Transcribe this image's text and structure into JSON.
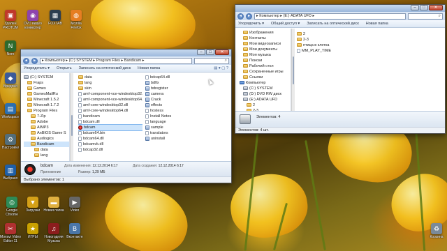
{
  "desktop": {
    "icons": [
      {
        "label": "Удален PROTUM",
        "glyph": "▣",
        "color": "#c0392b"
      },
      {
        "label": "DVD видео конвертер",
        "glyph": "◉",
        "color": "#8e44ad"
      },
      {
        "label": "FOXTAB",
        "glyph": "▦",
        "color": "#2c3e50"
      },
      {
        "label": "Mozilla Firefox",
        "glyph": "◍",
        "color": "#e67e22"
      },
      {
        "label": "Nero",
        "glyph": "N",
        "color": "#2d6a2d"
      },
      {
        "label": "Вредоно",
        "glyph": "◆",
        "color": "#3b5b9a"
      },
      {
        "label": "Workspace",
        "glyph": "▤",
        "color": "#2c6fb0"
      },
      {
        "label": "Настройки",
        "glyph": "⚙",
        "color": "#546e7a"
      },
      {
        "label": "Выбрано",
        "glyph": "▥",
        "color": "#1f5fa8"
      },
      {
        "label": "Google Chrome",
        "glyph": "◎",
        "color": "#2e8b57"
      },
      {
        "label": "Загрузки",
        "glyph": "▼",
        "color": "#d4a017"
      },
      {
        "label": "Новая папка",
        "glyph": "▬",
        "color": "#e0b040"
      },
      {
        "label": "Video",
        "glyph": "▶",
        "color": "#666"
      },
      {
        "label": "Movavi Video Editor 11",
        "glyph": "✂",
        "color": "#b03030"
      },
      {
        "label": "ИГРЫ",
        "glyph": "★",
        "color": "#c9a100"
      },
      {
        "label": "Новогодняя Музыка",
        "glyph": "♫",
        "color": "#8b1d1d"
      },
      {
        "label": "Вконтакте",
        "glyph": "B",
        "color": "#4a76a8"
      },
      {
        "label": "Корзина",
        "glyph": "♻",
        "color": "#7a8a9a"
      }
    ]
  },
  "usb_window": {
    "address": "▸ Компьютер ▸ (E:) ADATA UFD ▸",
    "toolbar": [
      "Упорядочить ▾",
      "Общий доступ ▾",
      "Записать на оптический диск",
      "Новая папка"
    ],
    "tree": [
      {
        "label": "Изображения",
        "kind": "folder",
        "indent": 1
      },
      {
        "label": "Контакты",
        "kind": "folder",
        "indent": 1
      },
      {
        "label": "Мои видеозаписи",
        "kind": "folder",
        "indent": 1
      },
      {
        "label": "Мои документы",
        "kind": "folder",
        "indent": 1
      },
      {
        "label": "Моя музыка",
        "kind": "folder",
        "indent": 1
      },
      {
        "label": "Поиски",
        "kind": "folder",
        "indent": 1
      },
      {
        "label": "Рабочий стол",
        "kind": "folder",
        "indent": 1
      },
      {
        "label": "Сохраненные игры",
        "kind": "folder",
        "indent": 1
      },
      {
        "label": "Ссылки",
        "kind": "folder",
        "indent": 1
      },
      {
        "label": "Компьютер",
        "kind": "sys",
        "indent": 0
      },
      {
        "label": "(C:) SYSTEM",
        "kind": "drive",
        "indent": 1
      },
      {
        "label": "(D:) DVD RW диск",
        "kind": "drive",
        "indent": 1
      },
      {
        "label": "(E:) ADATA UFD",
        "kind": "drive",
        "indent": 1
      },
      {
        "label": "2",
        "kind": "folder",
        "indent": 2
      },
      {
        "label": "2-3",
        "kind": "folder",
        "indent": 2
      },
      {
        "label": "птица в клетка",
        "kind": "folder",
        "indent": 2
      }
    ],
    "files": [
      "2",
      "2-3",
      "птица в клетка",
      "MM_PLAY_TIME"
    ],
    "status_count": "Элементов: 4",
    "status_bar": "Элементов: 4 шт."
  },
  "bandicam_window": {
    "address": "▸ Компьютер ▸ (C:) SYSTEM ▸ Program Files ▸ Bandicam ▸",
    "toolbar": [
      "Упорядочить ▾",
      "Открыть",
      "Записать на оптический диск",
      "Новая папка"
    ],
    "tree": [
      {
        "label": "(C:) SYSTEM",
        "kind": "drive",
        "indent": 0
      },
      {
        "label": "Fraps",
        "kind": "folder",
        "indent": 1
      },
      {
        "label": "Games",
        "kind": "folder",
        "indent": 1
      },
      {
        "label": "GamesMailRu",
        "kind": "folder",
        "indent": 1
      },
      {
        "label": "Minecraft 1.5.2",
        "kind": "folder",
        "indent": 1
      },
      {
        "label": "Minecraft 1.7.2",
        "kind": "folder",
        "indent": 1
      },
      {
        "label": "Program Files",
        "kind": "folder",
        "indent": 1
      },
      {
        "label": "7-Zip",
        "kind": "folder",
        "indent": 2
      },
      {
        "label": "Adobe",
        "kind": "folder",
        "indent": 2
      },
      {
        "label": "AIMP3",
        "kind": "folder",
        "indent": 2
      },
      {
        "label": "AnBIOS Game S",
        "kind": "folder",
        "indent": 2
      },
      {
        "label": "Audiogics",
        "kind": "folder",
        "indent": 2
      },
      {
        "label": "Bandicam",
        "kind": "folder",
        "indent": 2,
        "selected": true
      },
      {
        "label": "data",
        "kind": "folder",
        "indent": 3
      },
      {
        "label": "lang",
        "kind": "folder",
        "indent": 3
      }
    ],
    "files_col1": [
      {
        "label": "data",
        "kind": "folder"
      },
      {
        "label": "lang",
        "kind": "folder"
      },
      {
        "label": "skin",
        "kind": "folder"
      },
      {
        "label": "amf-component-vce-windesktop32.dll",
        "kind": "doc"
      },
      {
        "label": "amf-component-vce-windesktop64.dll",
        "kind": "doc"
      },
      {
        "label": "amf-core-windesktop32.dll",
        "kind": "doc"
      },
      {
        "label": "amf-core-windesktop64.dll",
        "kind": "doc"
      },
      {
        "label": "bandicam",
        "kind": "doc"
      },
      {
        "label": "bdcam.dll",
        "kind": "doc"
      },
      {
        "label": "bdcam",
        "kind": "red",
        "selected": true
      },
      {
        "label": "bdcam64.bin",
        "kind": "doc"
      },
      {
        "label": "bdcam64.dll",
        "kind": "doc"
      },
      {
        "label": "bdcamvk.dll",
        "kind": "doc"
      },
      {
        "label": "bdcap32.dll",
        "kind": "doc"
      }
    ],
    "files_col2": [
      {
        "label": "bdcap64.dll",
        "kind": "doc"
      },
      {
        "label": "bdfix",
        "kind": "exe"
      },
      {
        "label": "bdregister",
        "kind": "exe"
      },
      {
        "label": "camera",
        "kind": "exe"
      },
      {
        "label": "Crack",
        "kind": "exe"
      },
      {
        "label": "effects",
        "kind": "exe"
      },
      {
        "label": "hostess",
        "kind": "doc"
      },
      {
        "label": "Install Notes",
        "kind": "doc"
      },
      {
        "label": "language",
        "kind": "doc"
      },
      {
        "label": "sample",
        "kind": "exe"
      },
      {
        "label": "translators",
        "kind": "doc"
      },
      {
        "label": "uninstall",
        "kind": "exe"
      }
    ],
    "details": {
      "name": "bdcam",
      "type": "Приложение",
      "modified_label": "Дата изменения:",
      "modified_value": "12.12.2014 6:17",
      "created_label": "Дата создания:",
      "created_value": "12.12.2014 6:17",
      "size_label": "Размер:",
      "size_value": "1,29 МБ"
    },
    "status_bar": "Выбрано элементов: 1"
  }
}
